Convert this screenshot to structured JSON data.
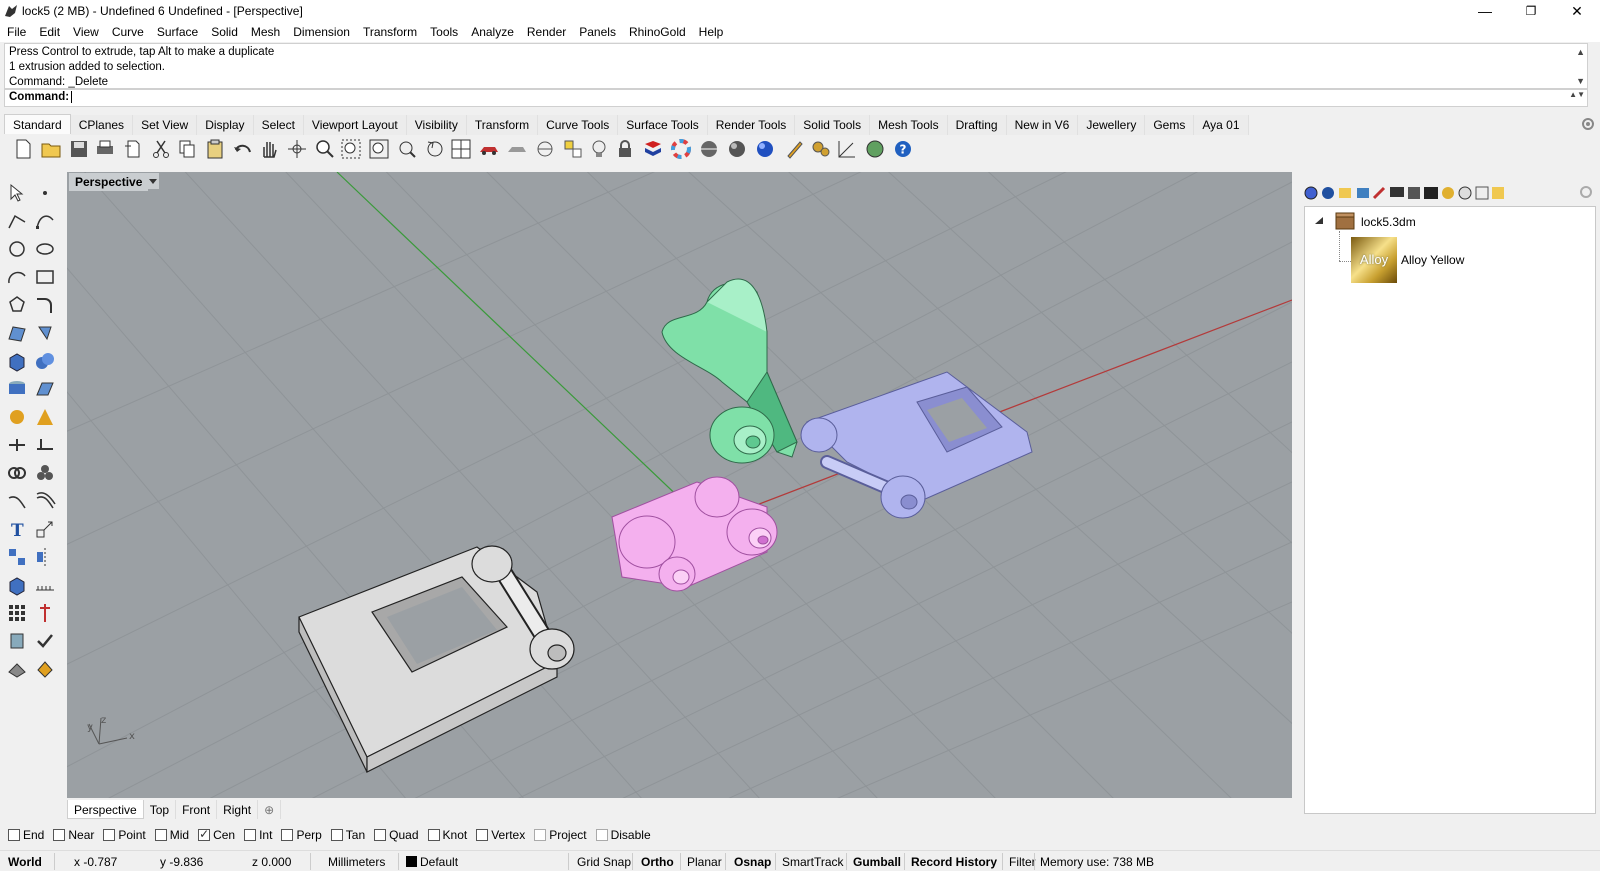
{
  "window": {
    "title": "lock5 (2 MB) - Undefined 6 Undefined - [Perspective]",
    "minimize": "—",
    "restore": "❐",
    "close": "✕"
  },
  "menu": [
    "File",
    "Edit",
    "View",
    "Curve",
    "Surface",
    "Solid",
    "Mesh",
    "Dimension",
    "Transform",
    "Tools",
    "Analyze",
    "Render",
    "Panels",
    "RhinoGold",
    "Help"
  ],
  "command_history": [
    "Press Control to extrude, tap Alt to make a duplicate",
    "1 extrusion added to selection.",
    "Command: _Delete"
  ],
  "command_prompt": {
    "label": "Command:",
    "value": ""
  },
  "toolbar_tabs": [
    {
      "label": "Standard",
      "active": true
    },
    {
      "label": "CPlanes"
    },
    {
      "label": "Set View"
    },
    {
      "label": "Display"
    },
    {
      "label": "Select"
    },
    {
      "label": "Viewport Layout"
    },
    {
      "label": "Visibility"
    },
    {
      "label": "Transform"
    },
    {
      "label": "Curve Tools"
    },
    {
      "label": "Surface Tools"
    },
    {
      "label": "Render Tools"
    },
    {
      "label": "Solid Tools"
    },
    {
      "label": "Mesh Tools"
    },
    {
      "label": "Drafting"
    },
    {
      "label": "New in V6"
    },
    {
      "label": "Jewellery"
    },
    {
      "label": "Gems"
    },
    {
      "label": "Aya 01"
    }
  ],
  "viewport": {
    "label": "Perspective",
    "axis_labels": {
      "x": "x",
      "y": "y",
      "z": "z"
    }
  },
  "viewport_tabs": [
    {
      "label": "Perspective",
      "active": true
    },
    {
      "label": "Top"
    },
    {
      "label": "Front"
    },
    {
      "label": "Right"
    },
    {
      "label": "⊕"
    }
  ],
  "materials_panel": {
    "file": "lock5.3dm",
    "material_thumb": "Alloy",
    "material_name": "Alloy Yellow"
  },
  "osnaps": [
    {
      "label": "End",
      "checked": false
    },
    {
      "label": "Near",
      "checked": false
    },
    {
      "label": "Point",
      "checked": false
    },
    {
      "label": "Mid",
      "checked": false
    },
    {
      "label": "Cen",
      "checked": true
    },
    {
      "label": "Int",
      "checked": false
    },
    {
      "label": "Perp",
      "checked": false
    },
    {
      "label": "Tan",
      "checked": false
    },
    {
      "label": "Quad",
      "checked": false
    },
    {
      "label": "Knot",
      "checked": false
    },
    {
      "label": "Vertex",
      "checked": false
    },
    {
      "label": "Project",
      "checked": false,
      "dim": true
    },
    {
      "label": "Disable",
      "checked": false,
      "dim": true
    }
  ],
  "status": {
    "cplane": "World",
    "x": "x -0.787",
    "y": "y -9.836",
    "z": "z 0.000",
    "units": "Millimeters",
    "layer": "Default",
    "grid_snap": "Grid Snap",
    "ortho": "Ortho",
    "planar": "Planar",
    "osnap": "Osnap",
    "smarttrack": "SmartTrack",
    "gumball": "Gumball",
    "record_history": "Record History",
    "filter": "Filter",
    "memory": "Memory use: 738 MB"
  },
  "colors": {
    "viewport_bg": "#9ba0a4",
    "grid": "#8e9397",
    "x_axis": "#b33a3a",
    "y_axis": "#3a9a3a",
    "green_part": "#7fe0a8",
    "purple_part": "#b0b4ee",
    "pink_part": "#f4b0ee",
    "white_part": "#dcdcdc"
  }
}
